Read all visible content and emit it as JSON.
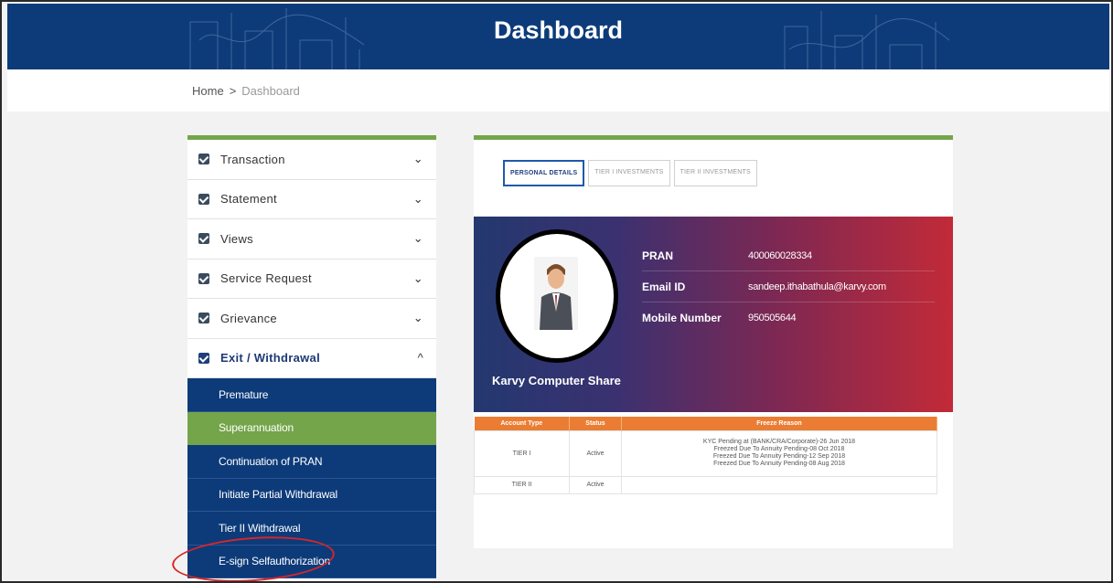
{
  "header": {
    "title": "Dashboard"
  },
  "breadcrumb": {
    "home": "Home",
    "separator": ">",
    "current": "Dashboard"
  },
  "sidebar": {
    "items": [
      {
        "label": "Transaction",
        "chevron": "chevron-down"
      },
      {
        "label": "Statement",
        "chevron": "chevron-down"
      },
      {
        "label": "Views",
        "chevron": "chevron-down"
      },
      {
        "label": "Service Request",
        "chevron": "chevron-down"
      },
      {
        "label": "Grievance",
        "chevron": "chevron-down"
      },
      {
        "label": "Exit / Withdrawal",
        "chevron": "chevron-up"
      }
    ],
    "chevron_down_glyph": "⌄",
    "chevron_up_glyph": "^",
    "submenu": [
      {
        "label": "Premature"
      },
      {
        "label": "Superannuation"
      },
      {
        "label": "Continuation of PRAN"
      },
      {
        "label": "Initiate Partial Withdrawal"
      },
      {
        "label": "Tier II Withdrawal"
      },
      {
        "label": "E-sign Selfauthorization"
      }
    ],
    "selected_submenu": "Superannuation"
  },
  "tabs": [
    {
      "label": "PERSONAL DETAILS",
      "active": true
    },
    {
      "label": "TIER I INVESTMENTS",
      "active": false
    },
    {
      "label": "TIER II INVESTMENTS",
      "active": false
    }
  ],
  "profile": {
    "company": "Karvy Computer Share",
    "fields": [
      {
        "key": "PRAN",
        "value": "400060028334"
      },
      {
        "key": "Email ID",
        "value": "sandeep.ithabathula@karvy.com"
      },
      {
        "key": "Mobile Number",
        "value": "950505644"
      }
    ]
  },
  "freeze_table": {
    "headers": [
      "Account Type",
      "Status",
      "Freeze Reason"
    ],
    "rows": [
      {
        "account_type": "TIER I",
        "status": "Active",
        "reasons": [
          "KYC Pending at (BANK/CRA/Corporate)-26 Jun 2018",
          "Freezed Due To Annuity Pending-08 Oct 2018",
          "Freezed Due To Annuity Pending-12 Sep 2018",
          "Freezed Due To Annuity Pending-08 Aug 2018"
        ]
      },
      {
        "account_type": "TIER II",
        "status": "Active",
        "reasons": [
          ""
        ]
      }
    ]
  },
  "colors": {
    "header_blue": "#0d3b7a",
    "accent_green": "#74a54a",
    "table_orange": "#ea7d33",
    "annotation_red": "#d6262a"
  }
}
